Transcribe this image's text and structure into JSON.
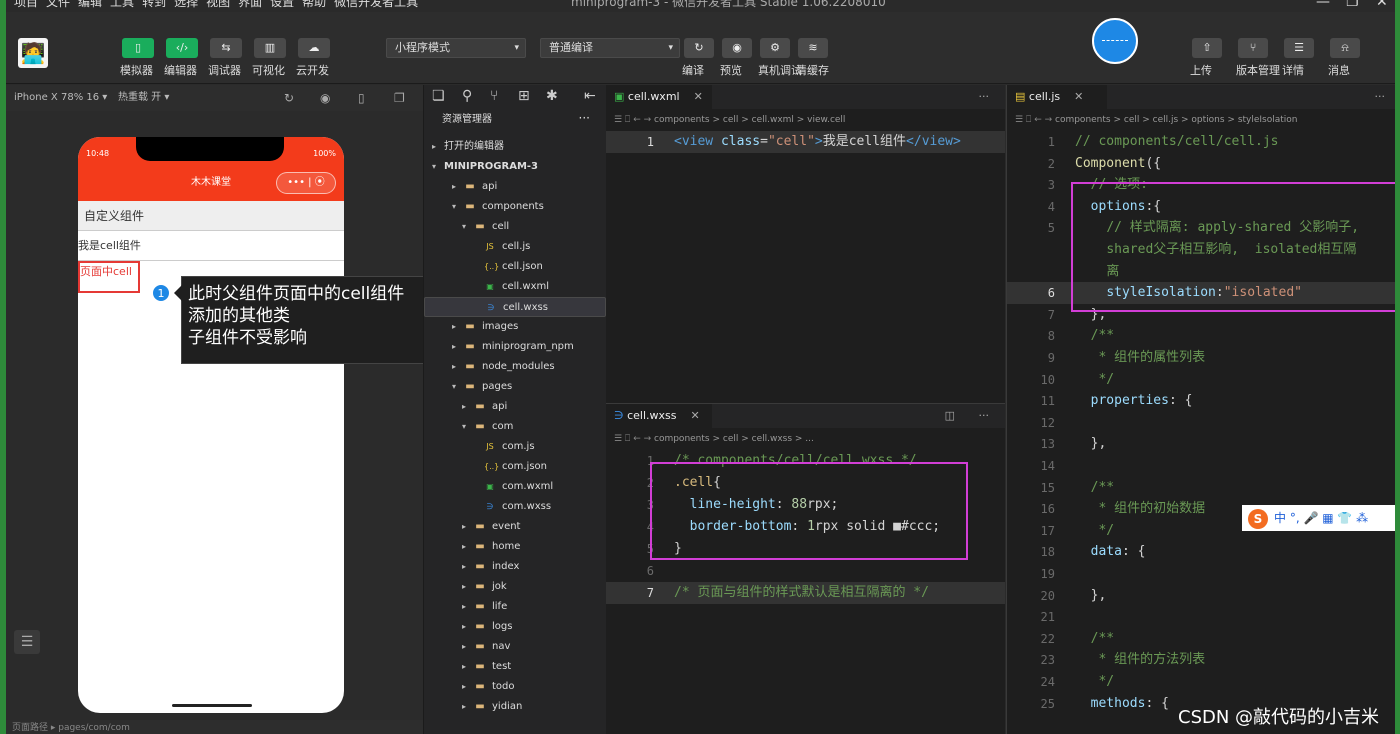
{
  "menubar": {
    "items": [
      "项目",
      "文件",
      "编辑",
      "工具",
      "转到",
      "选择",
      "视图",
      "界面",
      "设置",
      "帮助",
      "微信开发者工具"
    ],
    "title": "miniprogram-3 - 微信开发者工具 Stable 1.06.2208010"
  },
  "toolbar": {
    "left_buttons": [
      {
        "label": "模拟器",
        "icon": "phone-icon",
        "active": true
      },
      {
        "label": "编辑器",
        "icon": "code-icon",
        "active": true
      },
      {
        "label": "调试器",
        "icon": "debug-icon",
        "active": false
      },
      {
        "label": "可视化",
        "icon": "visual-icon",
        "active": false
      },
      {
        "label": "云开发",
        "icon": "cloud-icon",
        "active": false
      }
    ],
    "mode_select": "小程序模式",
    "compile_select": "普通编译",
    "mid_buttons": [
      {
        "label": "编译",
        "icon": "refresh-icon"
      },
      {
        "label": "预览",
        "icon": "eye-icon"
      },
      {
        "label": "真机调试",
        "icon": "bug-icon"
      },
      {
        "label": "清缓存",
        "icon": "layers-icon"
      }
    ],
    "right_buttons": [
      {
        "label": "上传",
        "icon": "upload-icon"
      },
      {
        "label": "版本管理",
        "icon": "branch-icon"
      },
      {
        "label": "详情",
        "icon": "menu-icon"
      },
      {
        "label": "消息",
        "icon": "bell-icon"
      }
    ]
  },
  "simulator": {
    "device": "iPhone X 78% 16 ▾",
    "hotreload": "热重载 开 ▾",
    "status_time": "10:48",
    "status_battery": "100%",
    "nav_title": "木木课堂",
    "capsule_dots": "•••",
    "capsule_close": "⦿",
    "row1": "自定义组件",
    "row2": "我是cell组件",
    "row3": "页面中cell",
    "footer": "页面路径 ▸ pages/com/com"
  },
  "callout": {
    "number": "1",
    "line1": "此时父组件页面中的cell组件",
    "line2": "添加的其他类",
    "line3": "子组件不受影响"
  },
  "explorer": {
    "header": "资源管理器",
    "open_editors": "打开的编辑器",
    "project": "MINIPROGRAM-3",
    "tree": [
      {
        "name": "api",
        "type": "folder",
        "depth": 1,
        "open": false
      },
      {
        "name": "components",
        "type": "folder",
        "depth": 1,
        "open": true
      },
      {
        "name": "cell",
        "type": "folder",
        "depth": 2,
        "open": true
      },
      {
        "name": "cell.js",
        "type": "js",
        "depth": 3
      },
      {
        "name": "cell.json",
        "type": "json",
        "depth": 3
      },
      {
        "name": "cell.wxml",
        "type": "wxml",
        "depth": 3
      },
      {
        "name": "cell.wxss",
        "type": "wxss",
        "depth": 3,
        "selected": true
      },
      {
        "name": "images",
        "type": "folder",
        "depth": 1,
        "open": false
      },
      {
        "name": "miniprogram_npm",
        "type": "folder",
        "depth": 1,
        "open": false
      },
      {
        "name": "node_modules",
        "type": "folder",
        "depth": 1,
        "open": false
      },
      {
        "name": "pages",
        "type": "folder",
        "depth": 1,
        "open": true
      },
      {
        "name": "api",
        "type": "folder",
        "depth": 2,
        "open": false
      },
      {
        "name": "com",
        "type": "folder",
        "depth": 2,
        "open": true
      },
      {
        "name": "com.js",
        "type": "js",
        "depth": 3
      },
      {
        "name": "com.json",
        "type": "json",
        "depth": 3
      },
      {
        "name": "com.wxml",
        "type": "wxml",
        "depth": 3
      },
      {
        "name": "com.wxss",
        "type": "wxss",
        "depth": 3
      },
      {
        "name": "event",
        "type": "folder",
        "depth": 2,
        "open": false
      },
      {
        "name": "home",
        "type": "folder",
        "depth": 2,
        "open": false
      },
      {
        "name": "index",
        "type": "folder",
        "depth": 2,
        "open": false
      },
      {
        "name": "jok",
        "type": "folder",
        "depth": 2,
        "open": false
      },
      {
        "name": "life",
        "type": "folder",
        "depth": 2,
        "open": false
      },
      {
        "name": "logs",
        "type": "folder",
        "depth": 2,
        "open": false
      },
      {
        "name": "nav",
        "type": "folder",
        "depth": 2,
        "open": false
      },
      {
        "name": "test",
        "type": "folder",
        "depth": 2,
        "open": false
      },
      {
        "name": "todo",
        "type": "folder",
        "depth": 2,
        "open": false
      },
      {
        "name": "yidian",
        "type": "folder",
        "depth": 2,
        "open": false
      }
    ]
  },
  "editor_wxml": {
    "tab": "cell.wxml",
    "crumbs": "components > cell > cell.wxml > view.cell",
    "lines": [
      {
        "n": "1",
        "html": "<span class='tg'>&lt;view</span> <span class='at'>class</span><span class='pl'>=</span><span class='str'>\"cell\"</span><span class='tg'>&gt;</span><span class='pl'>我是cell组件</span><span class='tg'>&lt;/view&gt;</span>"
      }
    ]
  },
  "editor_wxss": {
    "tab": "cell.wxss",
    "crumbs": "components > cell > cell.wxss > ...",
    "lines": [
      {
        "n": "1",
        "html": "<span class='cm'>/* components/cell/cell.wxss */</span>"
      },
      {
        "n": "2",
        "html": "<span class='sel2'>.cell</span><span class='pl'>{</span>"
      },
      {
        "n": "3",
        "html": "  <span class='prop'>line-height</span><span class='pl'>: </span><span class='num'>88</span><span class='pl'>rpx;</span>"
      },
      {
        "n": "4",
        "html": "  <span class='prop'>border-bottom</span><span class='pl'>: </span><span class='num'>1</span><span class='pl'>rpx solid </span><span class='pl'>■</span><span class='pl'>#ccc;</span>"
      },
      {
        "n": "5",
        "html": "<span class='pl'>}</span>"
      },
      {
        "n": "6",
        "html": ""
      },
      {
        "n": "7",
        "html": "<span class='cm'>/* 页面与组件的样式默认是相互隔离的 */</span>"
      }
    ]
  },
  "editor_js": {
    "tab": "cell.js",
    "crumbs": "components > cell > cell.js > options > styleIsolation",
    "lines": [
      {
        "n": "1",
        "html": "<span class='cm'>// components/cell/cell.js</span>"
      },
      {
        "n": "2",
        "html": "<span class='fn'>Component</span><span class='pl'>({</span>"
      },
      {
        "n": "3",
        "html": "  <span class='cm'>// 选项:</span>"
      },
      {
        "n": "4",
        "html": "  <span class='prop'>options</span><span class='pl'>:{</span>"
      },
      {
        "n": "5",
        "html": "    <span class='cm'>// 样式隔离: apply-shared 父影响子,</span>"
      },
      {
        "n": "",
        "html": "    <span class='cm'>shared父子相互影响,  isolated相互隔</span>"
      },
      {
        "n": "",
        "html": "    <span class='cm'>离</span>"
      },
      {
        "n": "6",
        "html": "    <span class='prop'>styleIsolation</span><span class='pl'>:</span><span class='str'>\"isolated\"</span>"
      },
      {
        "n": "7",
        "html": "  <span class='pl'>},</span>"
      },
      {
        "n": "8",
        "html": "  <span class='cm'>/**</span>"
      },
      {
        "n": "9",
        "html": "  <span class='cm'> * 组件的属性列表</span>"
      },
      {
        "n": "10",
        "html": "  <span class='cm'> */</span>"
      },
      {
        "n": "11",
        "html": "  <span class='prop'>properties</span><span class='pl'>: {</span>"
      },
      {
        "n": "12",
        "html": ""
      },
      {
        "n": "13",
        "html": "  <span class='pl'>},</span>"
      },
      {
        "n": "14",
        "html": ""
      },
      {
        "n": "15",
        "html": "  <span class='cm'>/**</span>"
      },
      {
        "n": "16",
        "html": "  <span class='cm'> * 组件的初始数据</span>"
      },
      {
        "n": "17",
        "html": "  <span class='cm'> */</span>"
      },
      {
        "n": "18",
        "html": "  <span class='prop'>data</span><span class='pl'>: {</span>"
      },
      {
        "n": "19",
        "html": ""
      },
      {
        "n": "20",
        "html": "  <span class='pl'>},</span>"
      },
      {
        "n": "21",
        "html": ""
      },
      {
        "n": "22",
        "html": "  <span class='cm'>/**</span>"
      },
      {
        "n": "23",
        "html": "  <span class='cm'> * 组件的方法列表</span>"
      },
      {
        "n": "24",
        "html": "  <span class='cm'> */</span>"
      },
      {
        "n": "25",
        "html": "  <span class='prop'>methods</span><span class='pl'>: {</span>"
      }
    ]
  },
  "ime": {
    "s": "S",
    "text": "中 °, 🎤 ▦ 👕 ⁂"
  },
  "watermark": "CSDN @敲代码的小吉米",
  "colors": {
    "accent_green": "#1aad5c",
    "highlight_magenta": "#d23ed6",
    "nav_red": "#f33b1b",
    "callout_blue": "#1e88e5"
  }
}
